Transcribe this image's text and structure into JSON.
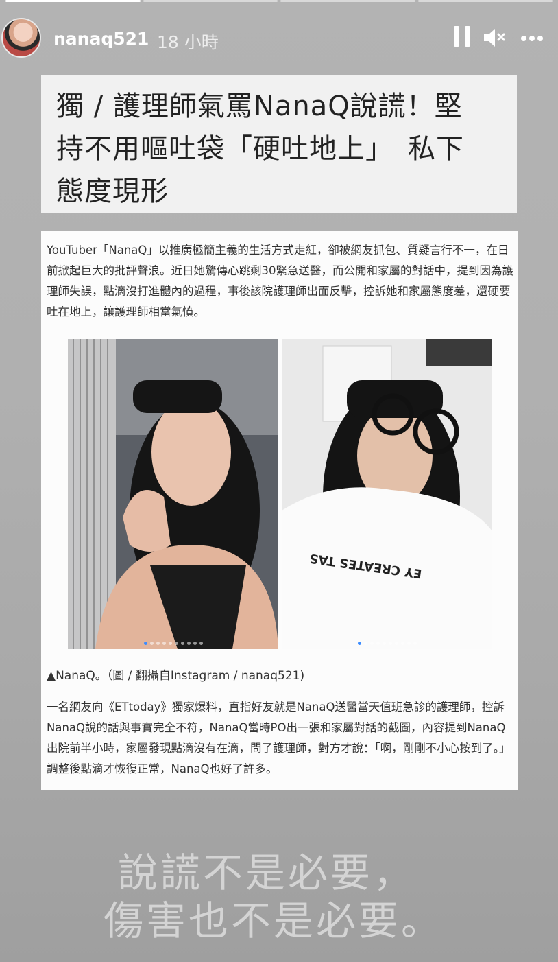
{
  "story": {
    "username": "nanaq521",
    "time_ago": "18 小時",
    "segments_total": 4,
    "segments_done": 1
  },
  "icons": {
    "pause": "pause-icon",
    "mute": "speaker-muted-icon",
    "more": "more-horizontal-icon"
  },
  "headline": {
    "line1": "獨 / 護理師氣罵NanaQ說謊！堅",
    "line2": "持不用嘔吐袋「硬吐地上」　私下",
    "line3": "態度現形"
  },
  "article": {
    "para1": "YouTuber「NanaQ」以推廣極簡主義的生活方式走紅，卻被網友抓包、質疑言行不一，在日前掀起巨大的批評聲浪。近日她驚傳心跳剩30緊急送醫，而公開和家屬的對話中，提到因為護理師失誤，點滴沒打進體內的過程，事後該院護理師出面反擊，控訴她和家屬態度差，還硬要吐在地上，讓護理師相當氣憤。",
    "photo_right_shirt": "EY CREATES TAS",
    "caption": "▲NanaQ。（圖 / 翻攝自Instagram / nanaq521)",
    "para2": "一名網友向《ETtoday》獨家爆料，直指好友就是NanaQ送醫當天值班急診的護理師，控訴NanaQ說的話與事實完全不符，NanaQ當時PO出一張和家屬對話的截圖，內容提到NanaQ出院前半小時，家屬發現點滴沒有在滴，問了護理師，對方才說：「啊，剛剛不小心按到了。」調整後點滴才恢復正常，NanaQ也好了許多。"
  },
  "overlay": {
    "line1": "說謊不是必要，",
    "line2": "傷害也不是必要。"
  },
  "colors": {
    "background": "#b0b0b0",
    "overlay_text": "#d4d4d4",
    "carousel_active_dot": "#3b8cff"
  }
}
